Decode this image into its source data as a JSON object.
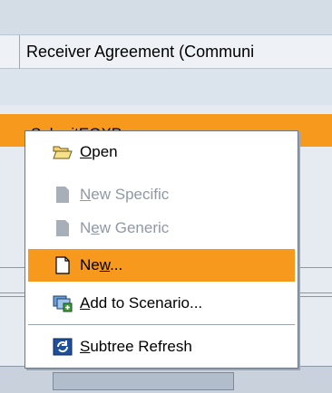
{
  "table": {
    "column_header": "Receiver Agreement (Communi",
    "selected_row_text": "SubmitEOXP"
  },
  "context_menu": {
    "items": [
      {
        "label": "Open",
        "mnemonic_index": 0,
        "enabled": true,
        "highlighted": false,
        "icon": "folder-open-icon"
      },
      {
        "label": "New Specific",
        "mnemonic_index": 0,
        "enabled": false,
        "highlighted": false,
        "icon": "document-icon"
      },
      {
        "label": "New Generic",
        "mnemonic_index": 1,
        "enabled": false,
        "highlighted": false,
        "icon": "document-icon"
      },
      {
        "label": "New...",
        "mnemonic_index": 2,
        "enabled": true,
        "highlighted": true,
        "icon": "new-document-icon"
      },
      {
        "label": "Add to Scenario...",
        "mnemonic_index": 0,
        "enabled": true,
        "highlighted": false,
        "icon": "add-to-scenario-icon"
      },
      {
        "label": "Subtree Refresh",
        "mnemonic_index": 0,
        "enabled": true,
        "highlighted": false,
        "icon": "refresh-icon"
      }
    ]
  },
  "colors": {
    "highlight": "#f7991d",
    "disabled_text": "#8f98a4",
    "header_bg": "#eef2f7"
  }
}
